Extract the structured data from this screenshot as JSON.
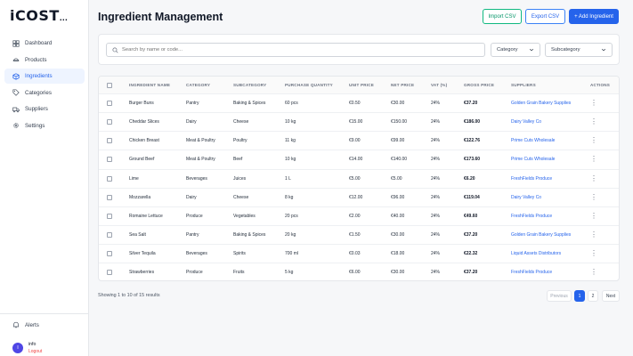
{
  "app": {
    "logo": "iCOST",
    "logo_suffix": "..."
  },
  "sidebar": {
    "items": [
      {
        "label": "Dashboard",
        "icon": "dashboard-icon",
        "active": false
      },
      {
        "label": "Products",
        "icon": "products-icon",
        "active": false
      },
      {
        "label": "Ingredients",
        "icon": "ingredients-icon",
        "active": true
      },
      {
        "label": "Categories",
        "icon": "categories-icon",
        "active": false
      },
      {
        "label": "Suppliers",
        "icon": "truck-icon",
        "active": false
      },
      {
        "label": "Settings",
        "icon": "gear-icon",
        "active": false
      }
    ],
    "alerts_label": "Alerts",
    "user": {
      "initial": "I",
      "name": "info",
      "logout_label": "Logout"
    }
  },
  "header": {
    "title": "Ingredient Management",
    "import_label": "Import CSV",
    "export_label": "Export CSV",
    "add_label": "+ Add Ingredient"
  },
  "filters": {
    "search_placeholder": "Search by name or code...",
    "category_label": "Category",
    "subcategory_label": "Subcategory"
  },
  "table": {
    "headers": [
      "INGREDIENT NAME",
      "CATEGORY",
      "SUBCATEGORY",
      "PURCHASE QUANTITY",
      "UNIT PRICE",
      "NET PRICE",
      "VAT (%)",
      "GROSS PRICE",
      "SUPPLIERS",
      "ACTIONS"
    ],
    "rows": [
      [
        "Burger Buns",
        "Pantry",
        "Baking & Spices",
        "60 pcs",
        "€0.50",
        "€30.00",
        "24%",
        "€37.20",
        "Golden Grain Bakery Supplies"
      ],
      [
        "Cheddar Slices",
        "Dairy",
        "Cheese",
        "10 kg",
        "€15.00",
        "€150.00",
        "24%",
        "€186.00",
        "Dairy Valley Co"
      ],
      [
        "Chicken Breast",
        "Meat & Poultry",
        "Poultry",
        "11 kg",
        "€9.00",
        "€99.00",
        "24%",
        "€122.76",
        "Prime Cuts Wholesale"
      ],
      [
        "Ground Beef",
        "Meat & Poultry",
        "Beef",
        "10 kg",
        "€14.00",
        "€140.00",
        "24%",
        "€173.60",
        "Prime Cuts Wholesale"
      ],
      [
        "Lime",
        "Beverages",
        "Juices",
        "1 L",
        "€5.00",
        "€5.00",
        "24%",
        "€6.20",
        "FreshFields Produce"
      ],
      [
        "Mozzarella",
        "Dairy",
        "Cheese",
        "8 kg",
        "€12.00",
        "€96.00",
        "24%",
        "€119.04",
        "Dairy Valley Co"
      ],
      [
        "Romaine Lettuce",
        "Produce",
        "Vegetables",
        "20 pcs",
        "€2.00",
        "€40.00",
        "24%",
        "€49.60",
        "FreshFields Produce"
      ],
      [
        "Sea Salt",
        "Pantry",
        "Baking & Spices",
        "20 kg",
        "€1.50",
        "€30.00",
        "24%",
        "€37.20",
        "Golden Grain Bakery Supplies"
      ],
      [
        "Silver Tequila",
        "Beverages",
        "Spirits",
        "700 ml",
        "€0.03",
        "€18.00",
        "24%",
        "€22.32",
        "Liquid Assets Distributors"
      ],
      [
        "Strawberries",
        "Produce",
        "Fruits",
        "5 kg",
        "€6.00",
        "€30.00",
        "24%",
        "€37.20",
        "FreshFields Produce"
      ]
    ]
  },
  "pagination": {
    "info": "Showing 1 to 10 of 15 results",
    "prev_label": "Previous",
    "pages": [
      "1",
      "2"
    ],
    "next_label": "Next"
  }
}
